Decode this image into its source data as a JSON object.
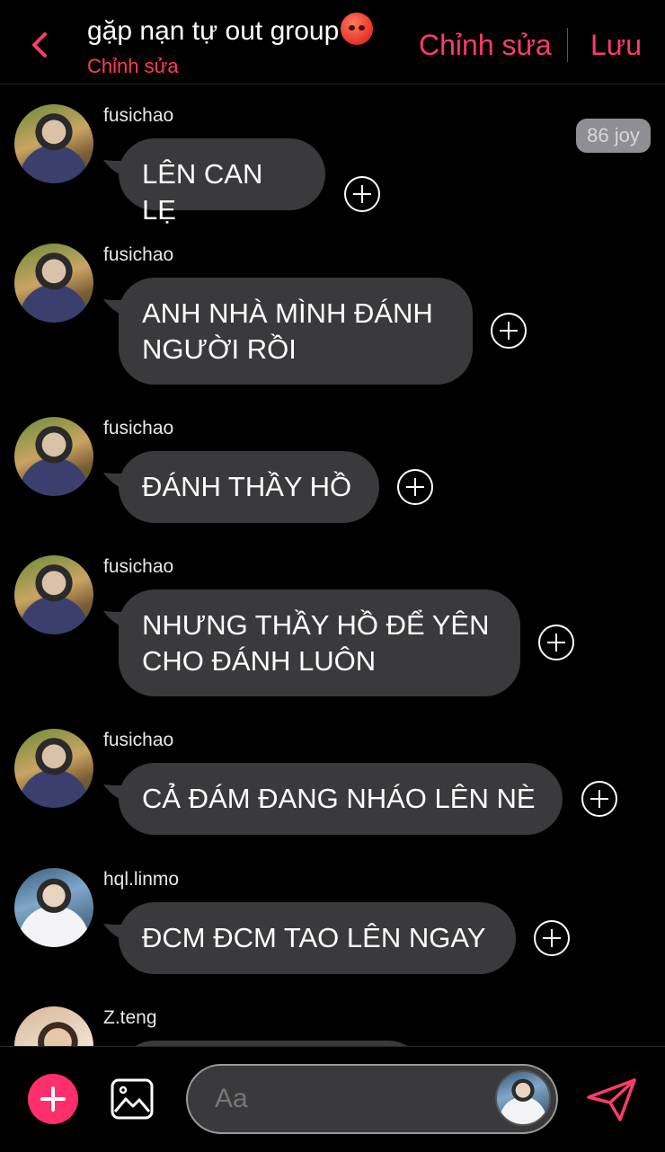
{
  "header": {
    "title": "gặp nạn tự out group",
    "title_emoji": "angry-face-emoji",
    "subtitle": "Chỉnh sửa",
    "edit_label": "Chỉnh sửa",
    "save_label": "Lưu",
    "accent_color": "#ff3b6b"
  },
  "messages": [
    {
      "user": "fusichao",
      "lines": [
        "LÊN CAN LẸ"
      ],
      "badge": "86 joy"
    },
    {
      "user": "fusichao",
      "lines": [
        "ANH NHÀ MÌNH ĐÁNH",
        "NGƯỜI RỒI"
      ]
    },
    {
      "user": "fusichao",
      "lines": [
        "ĐÁNH THẦY HỒ"
      ]
    },
    {
      "user": "fusichao",
      "lines": [
        "NHƯNG THẦY HỒ ĐỂ YÊN",
        "CHO ĐÁNH LUÔN"
      ]
    },
    {
      "user": "fusichao",
      "lines": [
        "CẢ ĐÁM ĐANG NHÁO LÊN NÈ"
      ]
    },
    {
      "user": "hql.linmo",
      "lines": [
        "ĐCM ĐCM TAO LÊN NGAY"
      ]
    },
    {
      "user": "Z.teng",
      "lines": []
    }
  ],
  "composer": {
    "placeholder": "Aa",
    "add_icon": "plus-icon",
    "image_icon": "image-icon",
    "send_icon": "send-icon",
    "add_color": "#ff2f6e"
  }
}
